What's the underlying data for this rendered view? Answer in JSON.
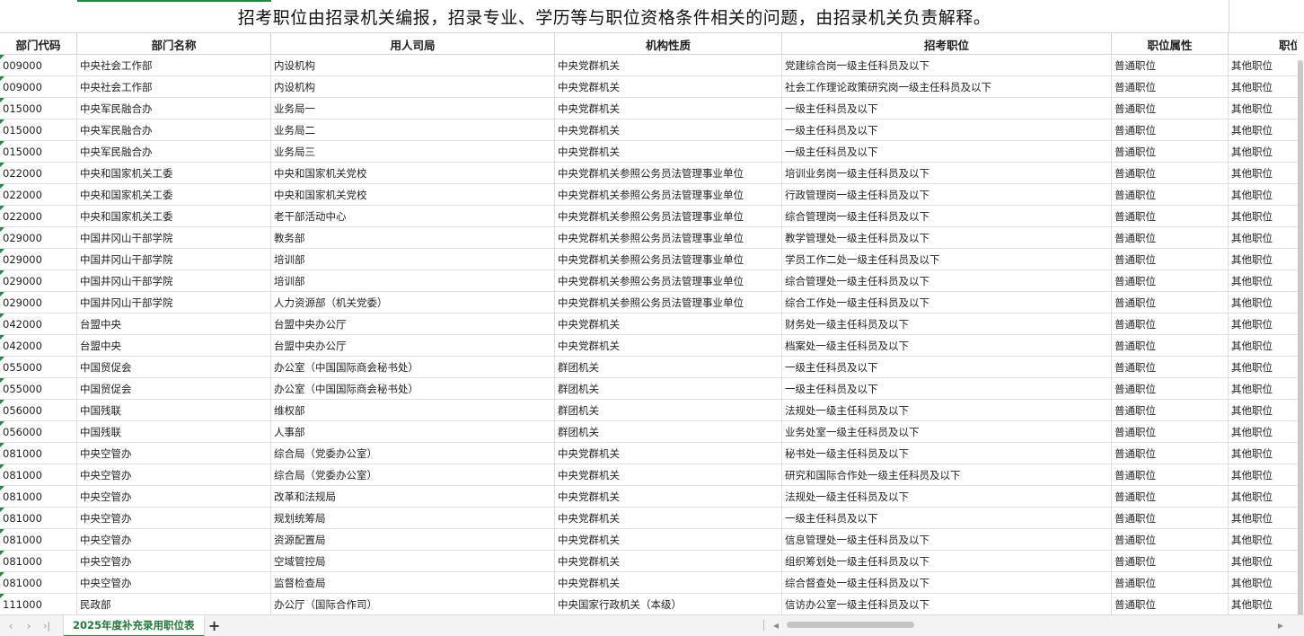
{
  "title": "招考职位由招录机关编报，招录专业、学历等与职位资格条件相关的问题，由招录机关负责解释。",
  "headers": [
    "部门代码",
    "部门名称",
    "用人司局",
    "机构性质",
    "招考职位",
    "职位属性",
    "职位"
  ],
  "rows": [
    [
      "009000",
      "中央社会工作部",
      "内设机构",
      "中央党群机关",
      "党建综合岗一级主任科员及以下",
      "普通职位",
      "其他职位"
    ],
    [
      "009000",
      "中央社会工作部",
      "内设机构",
      "中央党群机关",
      "社会工作理论政策研究岗一级主任科员及以下",
      "普通职位",
      "其他职位"
    ],
    [
      "015000",
      "中央军民融合办",
      "业务局一",
      "中央党群机关",
      "一级主任科员及以下",
      "普通职位",
      "其他职位"
    ],
    [
      "015000",
      "中央军民融合办",
      "业务局二",
      "中央党群机关",
      "一级主任科员及以下",
      "普通职位",
      "其他职位"
    ],
    [
      "015000",
      "中央军民融合办",
      "业务局三",
      "中央党群机关",
      "一级主任科员及以下",
      "普通职位",
      "其他职位"
    ],
    [
      "022000",
      "中央和国家机关工委",
      "中央和国家机关党校",
      "中央党群机关参照公务员法管理事业单位",
      "培训业务岗一级主任科员及以下",
      "普通职位",
      "其他职位"
    ],
    [
      "022000",
      "中央和国家机关工委",
      "中央和国家机关党校",
      "中央党群机关参照公务员法管理事业单位",
      "行政管理岗一级主任科员及以下",
      "普通职位",
      "其他职位"
    ],
    [
      "022000",
      "中央和国家机关工委",
      "老干部活动中心",
      "中央党群机关参照公务员法管理事业单位",
      "综合管理岗一级主任科员及以下",
      "普通职位",
      "其他职位"
    ],
    [
      "029000",
      "中国井冈山干部学院",
      "教务部",
      "中央党群机关参照公务员法管理事业单位",
      "教学管理处一级主任科员及以下",
      "普通职位",
      "其他职位"
    ],
    [
      "029000",
      "中国井冈山干部学院",
      "培训部",
      "中央党群机关参照公务员法管理事业单位",
      "学员工作二处一级主任科员及以下",
      "普通职位",
      "其他职位"
    ],
    [
      "029000",
      "中国井冈山干部学院",
      "培训部",
      "中央党群机关参照公务员法管理事业单位",
      "综合管理处一级主任科员及以下",
      "普通职位",
      "其他职位"
    ],
    [
      "029000",
      "中国井冈山干部学院",
      "人力资源部（机关党委）",
      "中央党群机关参照公务员法管理事业单位",
      "综合工作处一级主任科员及以下",
      "普通职位",
      "其他职位"
    ],
    [
      "042000",
      "台盟中央",
      "台盟中央办公厅",
      "中央党群机关",
      "财务处一级主任科员及以下",
      "普通职位",
      "其他职位"
    ],
    [
      "042000",
      "台盟中央",
      "台盟中央办公厅",
      "中央党群机关",
      "档案处一级主任科员及以下",
      "普通职位",
      "其他职位"
    ],
    [
      "055000",
      "中国贸促会",
      "办公室（中国国际商会秘书处）",
      "群团机关",
      "一级主任科员及以下",
      "普通职位",
      "其他职位"
    ],
    [
      "055000",
      "中国贸促会",
      "办公室（中国国际商会秘书处）",
      "群团机关",
      "一级主任科员及以下",
      "普通职位",
      "其他职位"
    ],
    [
      "056000",
      "中国残联",
      "维权部",
      "群团机关",
      "法规处一级主任科员及以下",
      "普通职位",
      "其他职位"
    ],
    [
      "056000",
      "中国残联",
      "人事部",
      "群团机关",
      "业务处室一级主任科员及以下",
      "普通职位",
      "其他职位"
    ],
    [
      "081000",
      "中央空管办",
      "综合局（党委办公室）",
      "中央党群机关",
      "秘书处一级主任科员及以下",
      "普通职位",
      "其他职位"
    ],
    [
      "081000",
      "中央空管办",
      "综合局（党委办公室）",
      "中央党群机关",
      "研究和国际合作处一级主任科员及以下",
      "普通职位",
      "其他职位"
    ],
    [
      "081000",
      "中央空管办",
      "改革和法规局",
      "中央党群机关",
      "法规处一级主任科员及以下",
      "普通职位",
      "其他职位"
    ],
    [
      "081000",
      "中央空管办",
      "规划统筹局",
      "中央党群机关",
      "一级主任科员及以下",
      "普通职位",
      "其他职位"
    ],
    [
      "081000",
      "中央空管办",
      "资源配置局",
      "中央党群机关",
      "信息管理处一级主任科员及以下",
      "普通职位",
      "其他职位"
    ],
    [
      "081000",
      "中央空管办",
      "空域管控局",
      "中央党群机关",
      "组织筹划处一级主任科员及以下",
      "普通职位",
      "其他职位"
    ],
    [
      "081000",
      "中央空管办",
      "监督检查局",
      "中央党群机关",
      "综合督查处一级主任科员及以下",
      "普通职位",
      "其他职位"
    ],
    [
      "111000",
      "民政部",
      "办公厅（国际合作司）",
      "中央国家行政机关（本级）",
      "信访办公室一级主任科员及以下",
      "普通职位",
      "其他职位"
    ]
  ],
  "tabs": {
    "sheet_name": "2025年度补充录用职位表",
    "nav_first": "‹",
    "nav_prev": "›",
    "nav_last": "›|",
    "add": "+"
  },
  "accent_color": "#1e8a3c"
}
